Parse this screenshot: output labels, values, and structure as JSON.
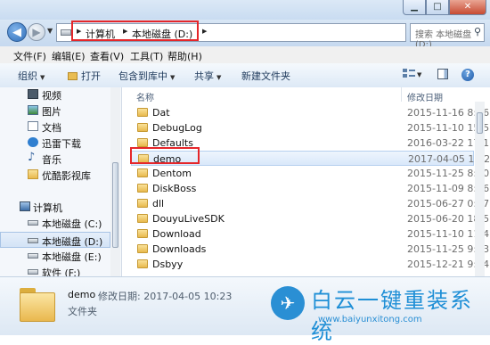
{
  "window": {
    "minimize": "▁",
    "maximize": "□",
    "close": "✕"
  },
  "nav": {
    "breadcrumbs": [
      "计算机",
      "本地磁盘 (D:)"
    ],
    "search_placeholder": "搜索 本地磁盘 (D:)"
  },
  "menu": [
    "文件(F)",
    "编辑(E)",
    "查看(V)",
    "工具(T)",
    "帮助(H)"
  ],
  "toolbar": {
    "organize": "组织",
    "open": "打开",
    "include_library": "包含到库中",
    "share": "共享",
    "new_folder": "新建文件夹"
  },
  "sidebar": {
    "items": [
      {
        "label": "视频",
        "icon": "video-library-icon"
      },
      {
        "label": "图片",
        "icon": "pictures-library-icon"
      },
      {
        "label": "文档",
        "icon": "documents-library-icon"
      },
      {
        "label": "迅雷下载",
        "icon": "thunder-download-icon"
      },
      {
        "label": "音乐",
        "icon": "music-library-icon"
      },
      {
        "label": "优酷影视库",
        "icon": "youku-library-icon"
      },
      {
        "label": "计算机",
        "icon": "computer-icon"
      },
      {
        "label": "本地磁盘 (C:)",
        "icon": "drive-icon"
      },
      {
        "label": "本地磁盘 (D:)",
        "icon": "drive-icon",
        "selected": true
      },
      {
        "label": "本地磁盘 (E:)",
        "icon": "drive-icon"
      },
      {
        "label": "软件 (F:)",
        "icon": "drive-icon"
      }
    ]
  },
  "columns": {
    "name": "名称",
    "modified": "修改日期"
  },
  "files": [
    {
      "name": "Dat",
      "date": "2015-11-16 8:36"
    },
    {
      "name": "DebugLog",
      "date": "2015-11-10 15:5"
    },
    {
      "name": "Defaults",
      "date": "2016-03-22 17:1"
    },
    {
      "name": "demo",
      "date": "2017-04-05 10:2",
      "selected": true
    },
    {
      "name": "Dentom",
      "date": "2015-11-25 8:50"
    },
    {
      "name": "DiskBoss",
      "date": "2015-11-09 8:56"
    },
    {
      "name": "dll",
      "date": "2015-06-27 0:37"
    },
    {
      "name": "DouyuLiveSDK",
      "date": "2015-06-20 18:5"
    },
    {
      "name": "Download",
      "date": "2015-11-10 11:4"
    },
    {
      "name": "Downloads",
      "date": "2015-11-25 9:53"
    },
    {
      "name": "Dsbyy",
      "date": "2015-12-21 9:54"
    }
  ],
  "details": {
    "name": "demo",
    "modified": "修改日期: 2017-04-05 10:23",
    "type": "文件夹"
  },
  "watermark": {
    "name": "白云一键重装系统",
    "url": "www.baiyunxitong.com"
  },
  "colors": {
    "highlight_box": "#e5262a",
    "brand": "#1f8fd6"
  }
}
